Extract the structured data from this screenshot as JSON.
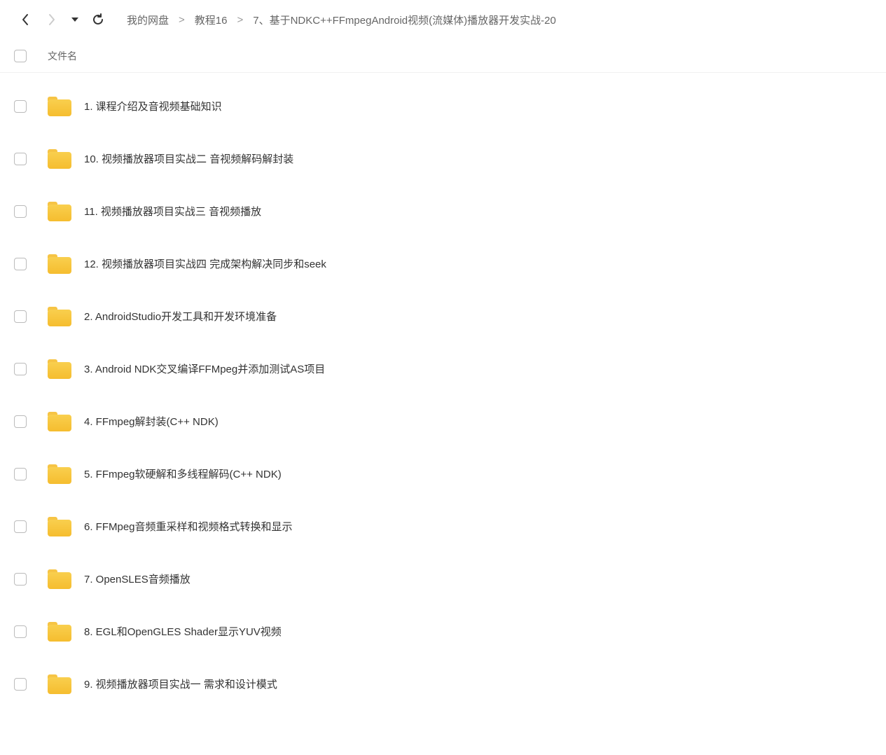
{
  "breadcrumb": {
    "items": [
      {
        "label": "我的网盘"
      },
      {
        "label": "教程16"
      },
      {
        "label": "7、基于NDKC++FFmpegAndroid视频(流媒体)播放器开发实战-20"
      }
    ],
    "separator": ">"
  },
  "columns": {
    "name": "文件名"
  },
  "files": [
    {
      "name": "1. 课程介绍及音视频基础知识"
    },
    {
      "name": "10. 视频播放器项目实战二 音视频解码解封装"
    },
    {
      "name": "11. 视频播放器项目实战三 音视频播放"
    },
    {
      "name": "12. 视频播放器项目实战四 完成架构解决同步和seek"
    },
    {
      "name": "2. AndroidStudio开发工具和开发环境准备"
    },
    {
      "name": "3. Android NDK交叉编译FFMpeg并添加测试AS项目"
    },
    {
      "name": "4. FFmpeg解封装(C++ NDK)"
    },
    {
      "name": "5. FFmpeg软硬解和多线程解码(C++ NDK)"
    },
    {
      "name": "6. FFMpeg音频重采样和视频格式转换和显示"
    },
    {
      "name": "7. OpenSLES音频播放"
    },
    {
      "name": "8. EGL和OpenGLES Shader显示YUV视频"
    },
    {
      "name": "9. 视频播放器项目实战一 需求和设计模式"
    }
  ]
}
